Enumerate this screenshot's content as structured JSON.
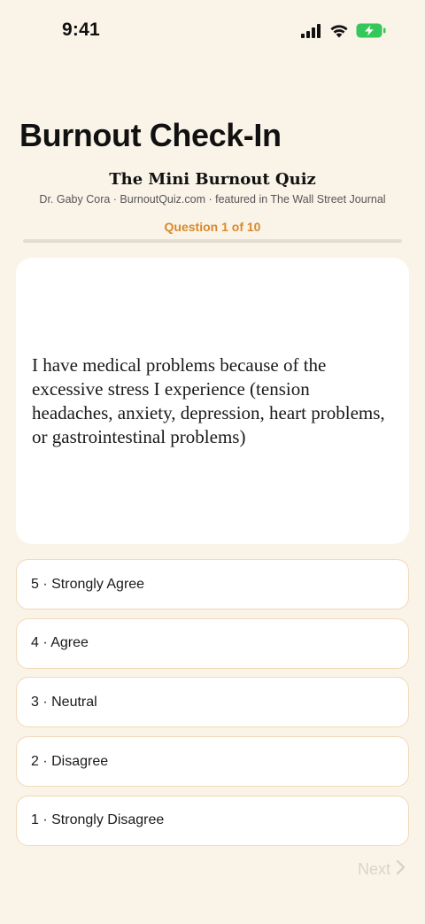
{
  "status_bar": {
    "time": "9:41",
    "battery_color": "#34c759"
  },
  "header": {
    "large_title": "Burnout Check-In",
    "quiz_title": "The Mini Burnout Quiz",
    "byline": "Dr. Gaby Cora · BurnoutQuiz.com · featured in The Wall Street Journal"
  },
  "progress": {
    "label": "Question 1 of 10",
    "current": 1,
    "total": 10,
    "fraction": 0.0,
    "accent_color": "#d9892c"
  },
  "question": {
    "text": "I have medical problems because of the excessive stress I experience (tension headaches, anxiety, depression, heart problems, or gastrointestinal problems)"
  },
  "options": [
    {
      "label": "5 · Strongly Agree"
    },
    {
      "label": "4 · Agree"
    },
    {
      "label": "3 · Neutral"
    },
    {
      "label": "2 · Disagree"
    },
    {
      "label": "1 · Strongly Disagree"
    }
  ],
  "footer": {
    "next_label": "Next",
    "next_icon": "chevron-right-icon",
    "next_enabled": false
  }
}
